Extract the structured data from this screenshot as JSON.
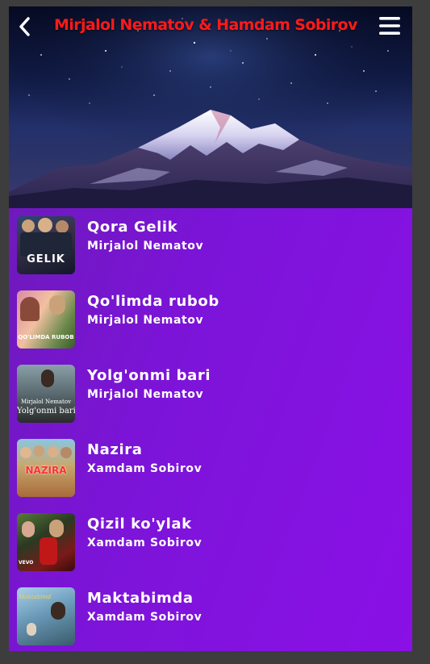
{
  "header": {
    "title": "Mirjalol Nematov & Hamdam Sobirov",
    "back_icon": "chevron-left-icon",
    "menu_icon": "hamburger-menu-icon",
    "title_color": "#ff1a1a"
  },
  "hero": {
    "image": "snowy-mountain-starry-sky"
  },
  "colors": {
    "list_bg": "#7c14d8",
    "text": "#ffffff"
  },
  "songs": [
    {
      "title": "Qora Gelik",
      "artist": "Mirjalol Nematov",
      "thumb_text": "GELIK"
    },
    {
      "title": "Qo'limda rubob",
      "artist": "Mirjalol Nematov",
      "thumb_text": "QO'LIMDA RUBOB"
    },
    {
      "title": "Yolg'onmi bari",
      "artist": "Mirjalol Nematov",
      "thumb_text": "Yolg'onmi bari",
      "thumb_text2": "Mirjalol Nematov"
    },
    {
      "title": "Nazira",
      "artist": "Xamdam Sobirov",
      "thumb_text": "NAZIRA"
    },
    {
      "title": "Qizil ko'ylak",
      "artist": "Xamdam Sobirov",
      "thumb_text": "VEVO"
    },
    {
      "title": "Maktabimda",
      "artist": "Xamdam Sobirov",
      "thumb_text": "Maktabimda"
    }
  ]
}
